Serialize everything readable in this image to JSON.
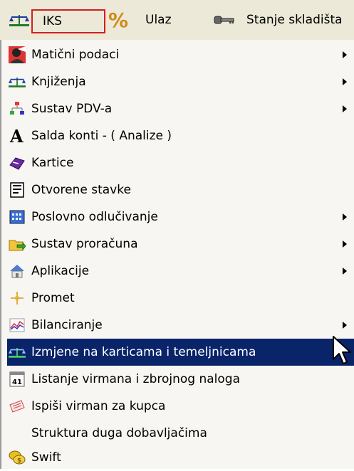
{
  "menubar": {
    "items": [
      {
        "label": "IKS",
        "icon": "scale-icon"
      },
      {
        "label": "%",
        "icon": "percent-icon"
      },
      {
        "label": "Ulaz"
      },
      {
        "label": "Stanje skladišta",
        "icon": "key-icon"
      }
    ]
  },
  "menu": {
    "items": [
      {
        "label": "Matični podaci",
        "icon": "person-icon",
        "submenu": true
      },
      {
        "label": "Knjiženja",
        "icon": "scale-icon",
        "submenu": true
      },
      {
        "label": "Sustav PDV-a",
        "icon": "tree-icon",
        "submenu": true
      },
      {
        "label": "Salda konti - ( Analize )",
        "icon": "font-a-icon",
        "submenu": false
      },
      {
        "label": "Kartice",
        "icon": "card-icon",
        "submenu": false
      },
      {
        "label": "Otvorene stavke",
        "icon": "document-icon",
        "submenu": false
      },
      {
        "label": "Poslovno odlučivanje",
        "icon": "grid-icon",
        "submenu": true
      },
      {
        "label": "Sustav proračuna",
        "icon": "folder-arrow-icon",
        "submenu": true
      },
      {
        "label": "Aplikacije",
        "icon": "house-icon",
        "submenu": true
      },
      {
        "label": "Promet",
        "icon": "star-icon",
        "submenu": false
      },
      {
        "label": "Bilanciranje",
        "icon": "chart-icon",
        "submenu": true
      },
      {
        "label": "Izmjene na karticama i temeljnicama",
        "icon": "scale-icon",
        "submenu": false,
        "selected": true
      },
      {
        "label": "Listanje virmana i zbrojnog naloga",
        "icon": "calendar-icon",
        "submenu": false,
        "calendar_text": "41"
      },
      {
        "label": "Ispiši virman za kupca",
        "icon": "cheque-icon",
        "submenu": false
      },
      {
        "label": "Struktura duga dobavljačima",
        "icon": "",
        "submenu": false
      },
      {
        "label": "Swift",
        "icon": "coins-icon",
        "submenu": false
      }
    ]
  },
  "colors": {
    "menubar_bg": "#ece9d8",
    "menu_bg": "#f7f6f2",
    "selection_bg": "#0a246a",
    "iks_border": "#d21f1f"
  }
}
